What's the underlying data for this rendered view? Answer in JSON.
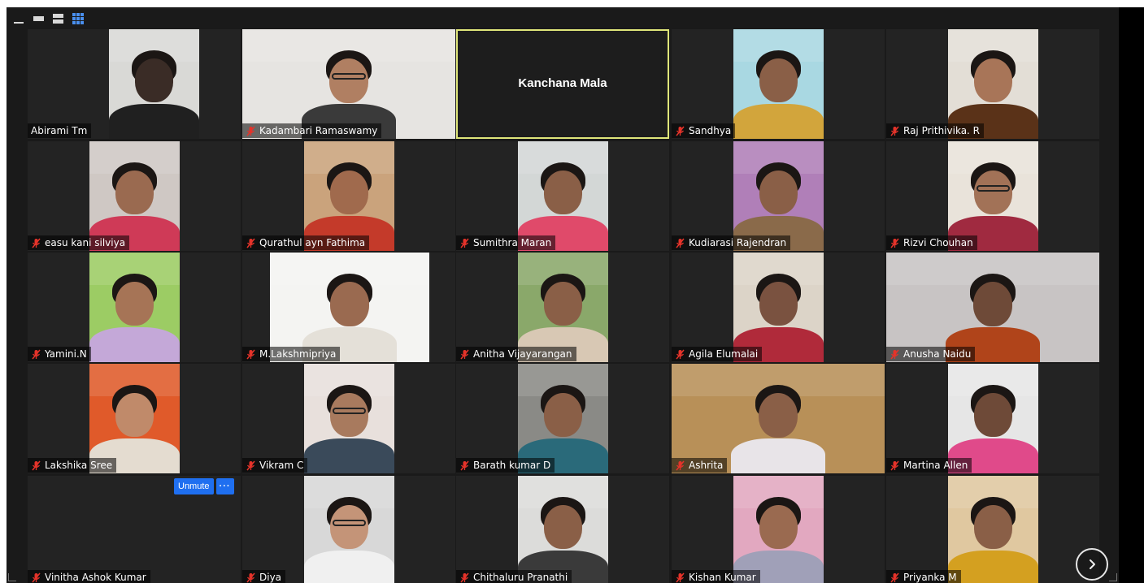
{
  "view_controls": [
    "minimize",
    "single-view",
    "speaker-view",
    "gallery-view"
  ],
  "center_participant": "Kanchana Mala",
  "participants": [
    {
      "name": "Abirami Tm",
      "muted": false
    },
    {
      "name": "Kadambari Ramaswamy",
      "muted": true
    },
    {
      "name": "Kanchana Mala",
      "muted": false,
      "active": true
    },
    {
      "name": "Sandhya",
      "muted": true
    },
    {
      "name": "Raj Prithivika. R",
      "muted": true
    },
    {
      "name": "easu kani silviya",
      "muted": true
    },
    {
      "name": "Qurathul ayn Fathima",
      "muted": true
    },
    {
      "name": "Sumithra Maran",
      "muted": true
    },
    {
      "name": "Kudiarasi Rajendran",
      "muted": true
    },
    {
      "name": "Rizvi Chouhan",
      "muted": true
    },
    {
      "name": "Yamini.N",
      "muted": true
    },
    {
      "name": "M.Lakshmipriya",
      "muted": true
    },
    {
      "name": "Anitha Vijayarangan",
      "muted": true
    },
    {
      "name": "Agila Elumalai",
      "muted": true
    },
    {
      "name": "Anusha Naidu",
      "muted": true
    },
    {
      "name": "Lakshika Sree",
      "muted": true
    },
    {
      "name": "Vikram C",
      "muted": true
    },
    {
      "name": "Barath kumar D",
      "muted": true
    },
    {
      "name": "Ashrita",
      "muted": true
    },
    {
      "name": "Martina Allen",
      "muted": true
    },
    {
      "name": "Vinitha Ashok Kumar",
      "muted": true
    },
    {
      "name": "Diya",
      "muted": true
    },
    {
      "name": "Chithaluru Pranathi",
      "muted": true
    },
    {
      "name": "Kishan Kumar",
      "muted": true
    },
    {
      "name": "Priyanka M",
      "muted": true
    }
  ],
  "hover_controls": {
    "unmute_label": "Unmute",
    "more_label": "···"
  },
  "colors": {
    "background": "#1a1a1a",
    "tile": "#232323",
    "active_border": "#dfe67a",
    "mic_off": "#e5332a",
    "accent": "#1f6ff0"
  },
  "icons": {
    "next_page": "chevron-right-icon",
    "mic_off": "mic-off-icon"
  }
}
